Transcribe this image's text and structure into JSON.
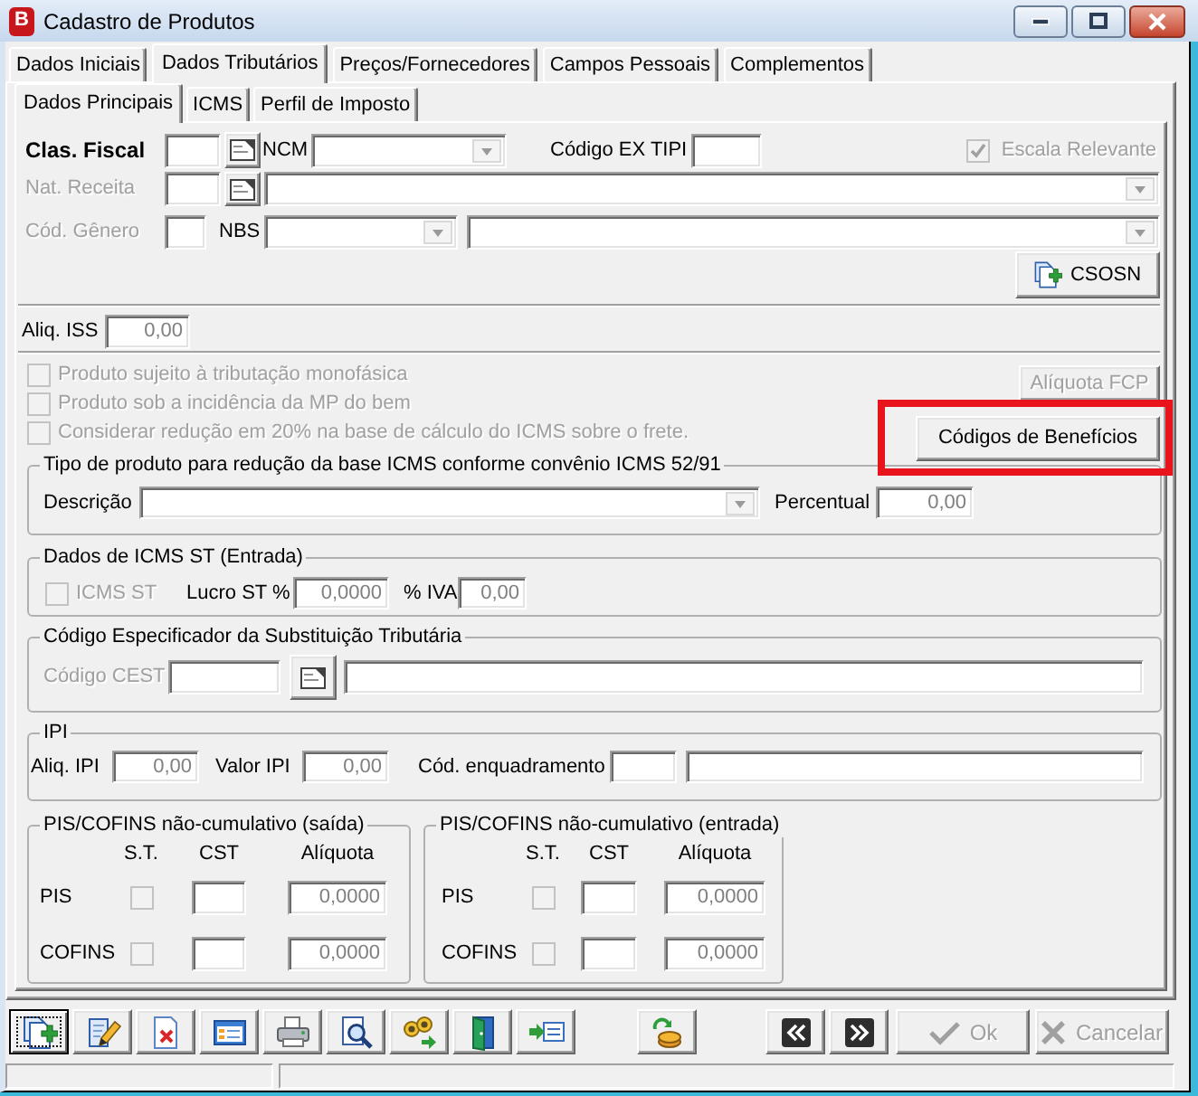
{
  "window": {
    "title": "Cadastro de Produtos",
    "icon_letter": "B"
  },
  "tabs": [
    {
      "label": "Dados Iniciais",
      "selected": false
    },
    {
      "label": "Dados Tributários",
      "selected": true
    },
    {
      "label": "Preços/Fornecedores",
      "selected": false
    },
    {
      "label": "Campos Pessoais",
      "selected": false
    },
    {
      "label": "Complementos",
      "selected": false
    }
  ],
  "subtabs": [
    {
      "label": "Dados Principais",
      "selected": true
    },
    {
      "label": "ICMS",
      "selected": false
    },
    {
      "label": "Perfil de Imposto",
      "selected": false
    }
  ],
  "classification": {
    "clas_fiscal_label": "Clas. Fiscal",
    "ncm_label": "NCM",
    "ex_tipi_label": "Código EX TIPI",
    "escala_relevante": {
      "label": "Escala Relevante",
      "checked": true,
      "disabled": true
    },
    "nat_receita": {
      "label": "Nat. Receita",
      "disabled": true
    },
    "cod_genero": {
      "label": "Cód. Gênero",
      "disabled": true
    },
    "nbs_label": "NBS",
    "csosn_button": "CSOSN"
  },
  "iss": {
    "label": "Aliq. ISS",
    "value": "0,00"
  },
  "options": [
    {
      "label": "Produto sujeito à tributação monofásica",
      "checked": false,
      "disabled": true
    },
    {
      "label": "Produto sob a incidência da MP do bem",
      "checked": false,
      "disabled": true
    },
    {
      "label": "Considerar redução em 20% na base de cálculo do ICMS sobre o frete.",
      "checked": false,
      "disabled": true
    }
  ],
  "side_buttons": [
    {
      "label": "Alíquota FCP",
      "disabled": true,
      "highlighted": false
    },
    {
      "label": "Códigos de Benefícios",
      "disabled": false,
      "highlighted": true
    }
  ],
  "convenio": {
    "title": "Tipo de produto para redução da base ICMS conforme convênio ICMS 52/91",
    "descricao_label": "Descrição",
    "percentual_label": "Percentual",
    "percentual_value": "0,00"
  },
  "icms_st": {
    "title": "Dados de ICMS ST (Entrada)",
    "checkbox": {
      "label": "ICMS ST",
      "checked": false,
      "disabled": true
    },
    "lucro_label": "Lucro ST %",
    "lucro_value": "0,0000",
    "iva_label": "% IVA",
    "iva_value": "0,00"
  },
  "cest": {
    "title": "Código Especificador da Substituição Tributária",
    "label": "Código CEST",
    "disabled": true
  },
  "ipi": {
    "title": "IPI",
    "aliq_label": "Aliq. IPI",
    "aliq_value": "0,00",
    "valor_label": "Valor IPI",
    "valor_value": "0,00",
    "enquadramento_label": "Cód. enquadramento"
  },
  "pis_cofins": [
    {
      "title": "PIS/COFINS não-cumulativo (saída)",
      "columns": [
        "S.T.",
        "CST",
        "Alíquota"
      ],
      "rows": [
        {
          "label": "PIS",
          "st": {
            "checked": false,
            "disabled": true
          },
          "aliquota": "0,0000"
        },
        {
          "label": "COFINS",
          "st": {
            "checked": false,
            "disabled": true
          },
          "aliquota": "0,0000"
        }
      ]
    },
    {
      "title": "PIS/COFINS não-cumulativo (entrada)",
      "columns": [
        "S.T.",
        "CST",
        "Alíquota"
      ],
      "rows": [
        {
          "label": "PIS",
          "st": {
            "checked": false,
            "disabled": true
          },
          "aliquota": "0,0000"
        },
        {
          "label": "COFINS",
          "st": {
            "checked": false,
            "disabled": true
          },
          "aliquota": "0,0000"
        }
      ]
    }
  ],
  "toolbar": {
    "main": [
      {
        "kind": "new",
        "focused": true
      },
      {
        "kind": "edit",
        "focused": false
      },
      {
        "kind": "delete",
        "focused": false
      },
      {
        "kind": "form",
        "focused": false
      },
      {
        "kind": "print",
        "focused": false
      },
      {
        "kind": "preview",
        "focused": false
      },
      {
        "kind": "find",
        "focused": false
      },
      {
        "kind": "exit",
        "focused": false
      },
      {
        "kind": "import",
        "focused": false
      }
    ],
    "extra": [
      {
        "kind": "prices",
        "focused": false
      }
    ]
  },
  "navigation": [
    {
      "kind": "previous"
    },
    {
      "kind": "next"
    }
  ],
  "actions": [
    {
      "kind": "ok",
      "label": "Ok",
      "disabled": true
    },
    {
      "kind": "cancel",
      "label": "Cancelar",
      "disabled": true
    }
  ]
}
